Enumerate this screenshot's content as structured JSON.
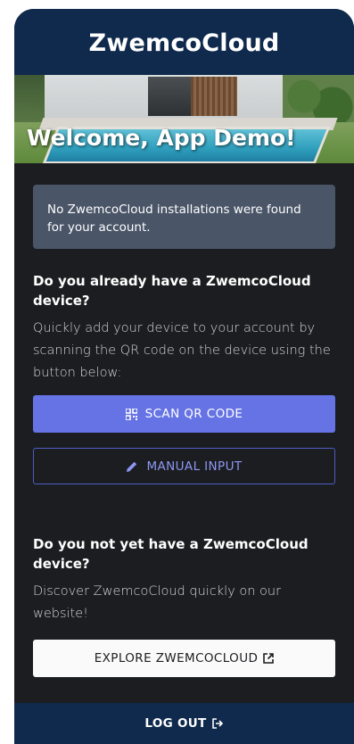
{
  "header": {
    "title": "ZwemcoCloud"
  },
  "hero": {
    "welcome_text": "Welcome, App Demo!"
  },
  "notice": {
    "text": "No ZwemcoCloud installations were found for your account."
  },
  "have_device": {
    "title": "Do you already have a ZwemcoCloud device?",
    "text": "Quickly add your device to your account by scanning the QR code on the device using the button below:"
  },
  "buttons": {
    "scan_qr": "SCAN QR CODE",
    "manual_input": "MANUAL INPUT",
    "explore": "EXPLORE ZWEMCOCLOUD",
    "logout": "LOG OUT"
  },
  "no_device": {
    "title": "Do you not yet have a ZwemcoCloud device?",
    "text": "Discover ZwemcoCloud quickly on our website!"
  },
  "icons": {
    "scan": "qr-code-icon",
    "edit": "pencil-icon",
    "external": "external-link-icon",
    "logout": "logout-icon"
  },
  "colors": {
    "header_bg": "#0f2a4d",
    "body_bg": "#1c1d20",
    "notice_bg": "#4a5568",
    "primary": "#6673e4",
    "outline": "#4f5cc4"
  }
}
